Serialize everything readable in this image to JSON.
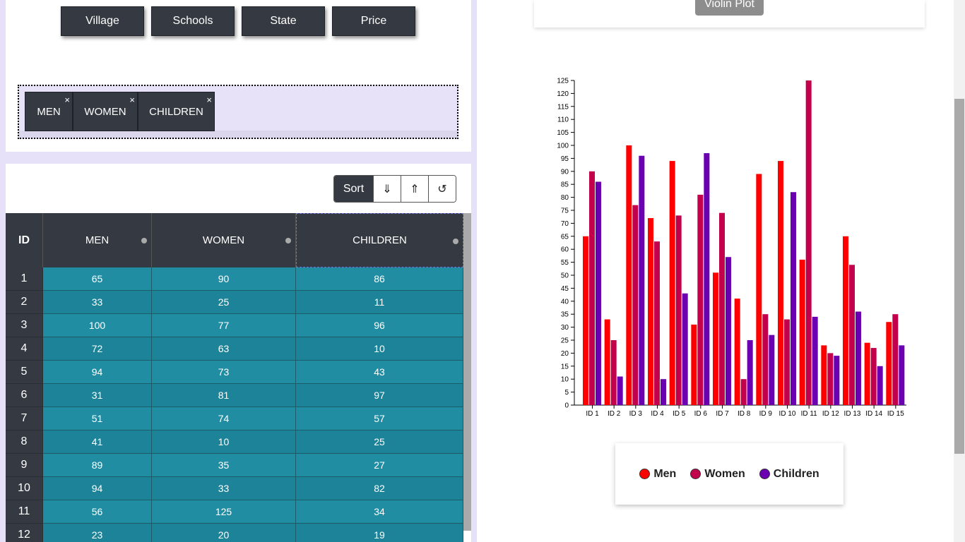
{
  "column_buttons": [
    "Village",
    "Schools",
    "State",
    "Price"
  ],
  "selected_chips": [
    "MEN",
    "WOMEN",
    "CHILDREN"
  ],
  "chip_close": "×",
  "sort": {
    "label": "Sort",
    "desc": "⇓",
    "asc": "⇑",
    "reset": "↺"
  },
  "table": {
    "headers": [
      "ID",
      "MEN",
      "WOMEN",
      "CHILDREN"
    ],
    "rows": [
      [
        "1",
        "65",
        "90",
        "86"
      ],
      [
        "2",
        "33",
        "25",
        "11"
      ],
      [
        "3",
        "100",
        "77",
        "96"
      ],
      [
        "4",
        "72",
        "63",
        "10"
      ],
      [
        "5",
        "94",
        "73",
        "43"
      ],
      [
        "6",
        "31",
        "81",
        "97"
      ],
      [
        "7",
        "51",
        "74",
        "57"
      ],
      [
        "8",
        "41",
        "10",
        "25"
      ],
      [
        "9",
        "89",
        "35",
        "27"
      ],
      [
        "10",
        "94",
        "33",
        "82"
      ],
      [
        "11",
        "56",
        "125",
        "34"
      ],
      [
        "12",
        "23",
        "20",
        "19"
      ]
    ]
  },
  "collapse_icon": "«",
  "violin_button": "Violin Plot",
  "legend": [
    {
      "label": "Men",
      "color": "#ff0000"
    },
    {
      "label": "Women",
      "color": "#c2004b"
    },
    {
      "label": "Children",
      "color": "#6a00b0"
    }
  ],
  "chart_data": {
    "type": "bar",
    "categories": [
      "ID 1",
      "ID 2",
      "ID 3",
      "ID 4",
      "ID 5",
      "ID 6",
      "ID 7",
      "ID 8",
      "ID 9",
      "ID 10",
      "ID 11",
      "ID 12",
      "ID 13",
      "ID 14",
      "ID 15"
    ],
    "series": [
      {
        "name": "Men",
        "color": "#ff0000",
        "values": [
          65,
          33,
          100,
          72,
          94,
          31,
          51,
          41,
          89,
          94,
          56,
          23,
          65,
          24,
          32
        ]
      },
      {
        "name": "Women",
        "color": "#c2004b",
        "values": [
          90,
          25,
          77,
          63,
          73,
          81,
          74,
          10,
          35,
          33,
          125,
          20,
          54,
          22,
          35
        ]
      },
      {
        "name": "Children",
        "color": "#6a00b0",
        "values": [
          86,
          11,
          96,
          10,
          43,
          97,
          57,
          25,
          27,
          82,
          34,
          19,
          36,
          15,
          23
        ]
      }
    ],
    "ylim": [
      0,
      125
    ],
    "yticks": [
      "0",
      "5",
      "10",
      "15",
      "20",
      "25",
      "30",
      "35",
      "40",
      "45",
      "50",
      "55",
      "60",
      "65",
      "70",
      "75",
      "80",
      "85",
      "90",
      "95",
      "100",
      "105",
      "110",
      "115",
      "120",
      "125"
    ]
  }
}
